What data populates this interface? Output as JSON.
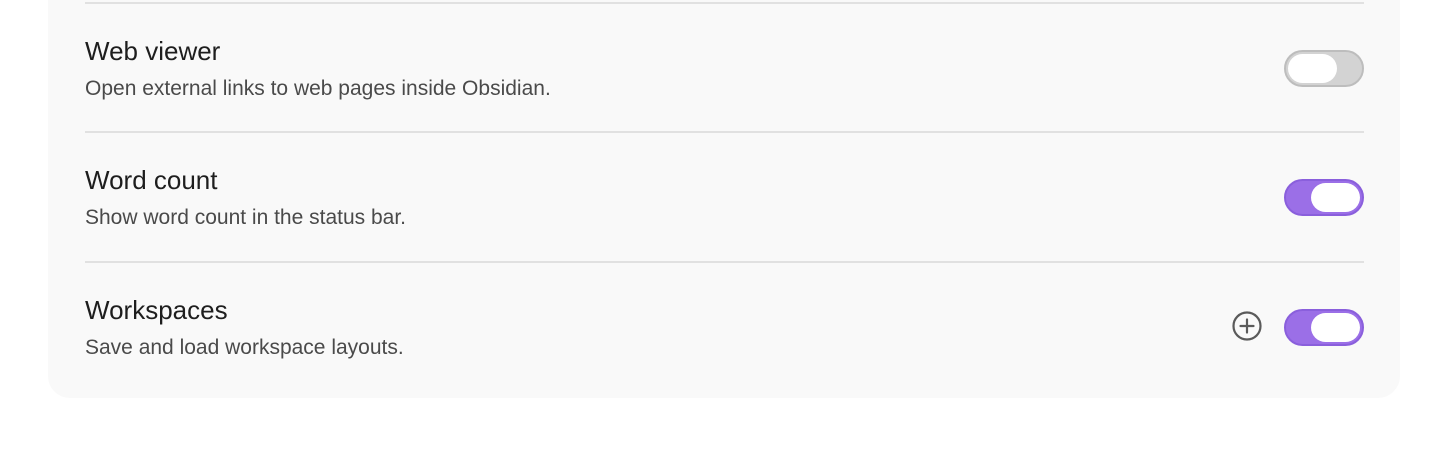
{
  "settings": [
    {
      "title": "Web viewer",
      "description": "Open external links to web pages inside Obsidian.",
      "enabled": false
    },
    {
      "title": "Word count",
      "description": "Show word count in the status bar.",
      "enabled": true
    },
    {
      "title": "Workspaces",
      "description": "Save and load workspace layouts.",
      "enabled": true,
      "extra_icon": "add-circle-icon"
    }
  ],
  "colors": {
    "toggle_on": "#9b6fe7",
    "toggle_off": "#d3d3d3",
    "panel_bg": "#f9f9f9"
  }
}
